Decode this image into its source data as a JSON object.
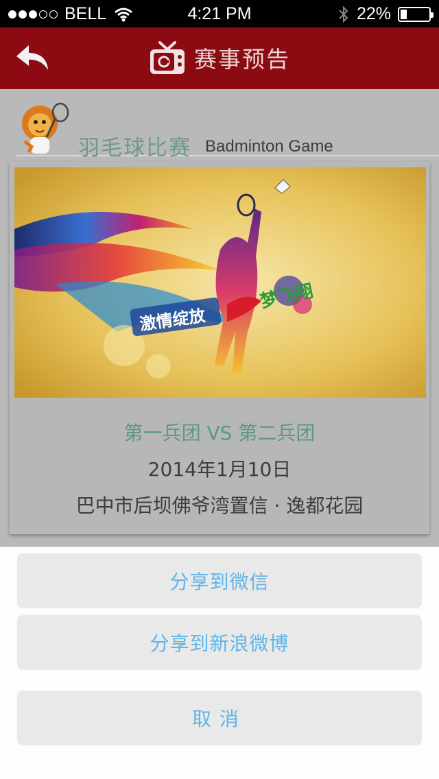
{
  "status_bar": {
    "carrier": "BELL",
    "time": "4:21 PM",
    "battery": "22%",
    "battery_level": 0.22,
    "signal_bars_filled": 3,
    "signal_bars_total": 5
  },
  "nav": {
    "title": "赛事预告",
    "back_icon": "back-arrow-icon",
    "title_icon": "tv-icon"
  },
  "section": {
    "title_cn": "羽毛球比赛",
    "title_en": "Badminton Game",
    "mascot_icon": "lion-mascot-icon"
  },
  "event": {
    "banner_text": "激情绽放 梦飞翔",
    "teams": "第一兵团 VS 第二兵团",
    "date": "2014年1月10日",
    "location": "巴中市后坝佛爷湾置信 · 逸都花园"
  },
  "share_sheet": {
    "wechat": "分享到微信",
    "weibo": "分享到新浪微博",
    "cancel": "取消"
  },
  "colors": {
    "nav_bg": "#8c0a12",
    "accent_blue": "#5fb4e8",
    "teal_text": "#5a988a"
  }
}
